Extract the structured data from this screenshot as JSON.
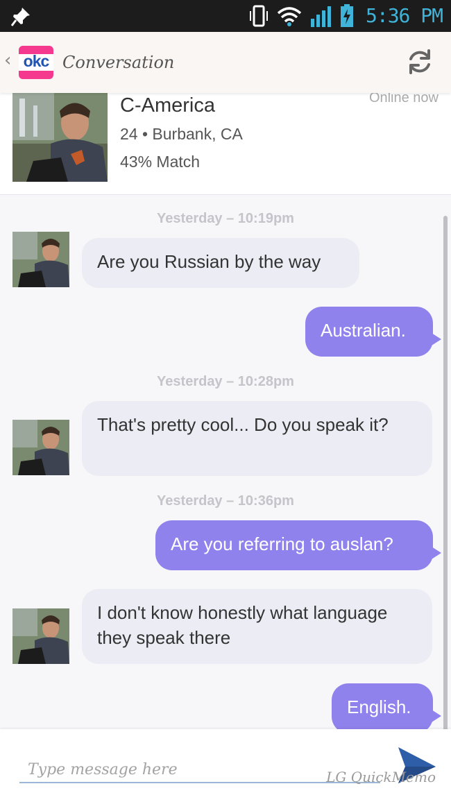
{
  "status_bar": {
    "time": "5:36 PM",
    "icons": [
      "pin-icon",
      "vibrate-icon",
      "wifi-icon",
      "signal-icon",
      "battery-charging-icon"
    ]
  },
  "app_bar": {
    "logo_text": "okc",
    "title": "Conversation",
    "back_icon": "chevron-left-icon",
    "refresh_icon": "refresh-icon"
  },
  "profile": {
    "name": "C-America",
    "age_location": "24 • Burbank, CA",
    "match": "43% Match",
    "online": "Online now"
  },
  "messages": [
    {
      "kind": "stamp",
      "text": "Yesterday – 10:19pm"
    },
    {
      "kind": "in",
      "text": "Are you Russian by the way"
    },
    {
      "kind": "out",
      "text": "Australian."
    },
    {
      "kind": "stamp",
      "text": "Yesterday – 10:28pm"
    },
    {
      "kind": "in",
      "text": "That's pretty cool... Do you speak it?"
    },
    {
      "kind": "stamp",
      "text": "Yesterday – 10:36pm"
    },
    {
      "kind": "out",
      "text": "Are you referring to auslan?"
    },
    {
      "kind": "in",
      "text": "I don't know honestly what language they speak there"
    },
    {
      "kind": "out",
      "text": "English."
    }
  ],
  "composer": {
    "placeholder": "Type message here",
    "send_icon": "send-icon",
    "memo_label": "LG QuickMemo"
  },
  "colors": {
    "outgoing_bubble": "#8f82ec",
    "incoming_bubble": "#ececf4",
    "logo_pink": "#f4398f",
    "logo_blue": "#2155b3",
    "status_accent": "#3fb3d8"
  }
}
